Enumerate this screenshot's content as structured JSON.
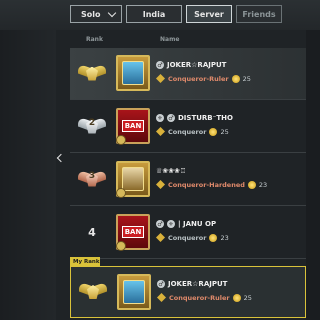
{
  "filters": {
    "mode": "Solo",
    "region": "India",
    "server": "Server",
    "friends": "Friends"
  },
  "columns": {
    "rank": "Rank",
    "name": "Name"
  },
  "rows": [
    {
      "rank": "1",
      "name": "JOKER☆RAJPUT",
      "tier": "Conqueror-Ruler",
      "level": "25",
      "banned": false
    },
    {
      "rank": "2",
      "name": "DISTURB⁻THO",
      "tier": "Conqueror",
      "level": "25",
      "banned": true,
      "ban_label": "BAN"
    },
    {
      "rank": "3",
      "name": "♕❀❀❀♖",
      "tier": "Conqueror-Hardened",
      "level": "23",
      "banned": false
    },
    {
      "rank": "4",
      "name": "| JANU OP",
      "tier": "Conqueror",
      "level": "23",
      "banned": true,
      "ban_label": "BAN"
    }
  ],
  "my_rank": {
    "tag": "My Rank",
    "name": "JOKER☆RAJPUT",
    "tier": "Conqueror-Ruler",
    "level": "25"
  },
  "colors": {
    "accent_gold": "#d9c23a",
    "tier_red": "#e08a6b",
    "ban_red": "#cc1d22"
  }
}
